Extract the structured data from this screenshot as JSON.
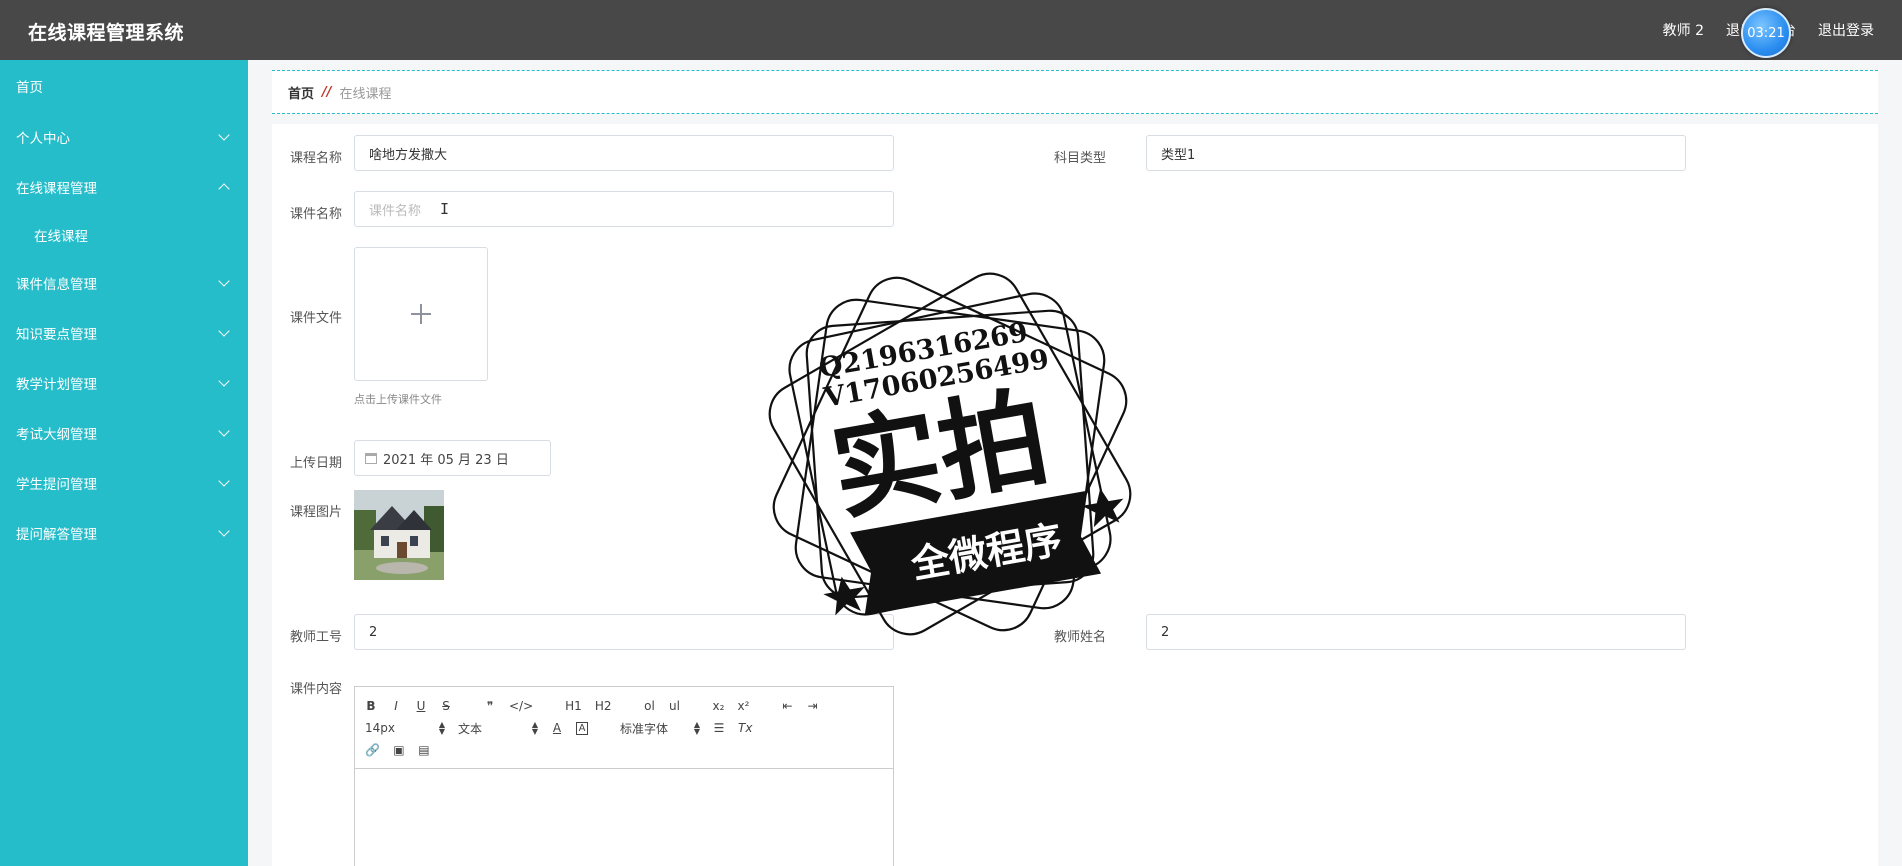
{
  "app": {
    "title": "在线课程管理系统"
  },
  "topbar": {
    "user": "教师 2",
    "return_front": "退出到前台",
    "logout": "退出登录",
    "timer": "03:21"
  },
  "sidebar": {
    "items": [
      {
        "label": "首页",
        "expandable": false
      },
      {
        "label": "个人中心",
        "expandable": true,
        "expanded": false
      },
      {
        "label": "在线课程管理",
        "expandable": true,
        "expanded": true,
        "children": [
          {
            "label": "在线课程"
          }
        ]
      },
      {
        "label": "课件信息管理",
        "expandable": true,
        "expanded": false
      },
      {
        "label": "知识要点管理",
        "expandable": true,
        "expanded": false
      },
      {
        "label": "教学计划管理",
        "expandable": true,
        "expanded": false
      },
      {
        "label": "考试大纲管理",
        "expandable": true,
        "expanded": false
      },
      {
        "label": "学生提问管理",
        "expandable": true,
        "expanded": false
      },
      {
        "label": "提问解答管理",
        "expandable": true,
        "expanded": false
      }
    ]
  },
  "breadcrumb": {
    "home": "首页",
    "separator": "//",
    "current": "在线课程"
  },
  "form": {
    "course_name": {
      "label": "课程名称",
      "value": "啥地方发撒大"
    },
    "subject_type": {
      "label": "科目类型",
      "value": "类型1"
    },
    "courseware_name": {
      "label": "课件名称",
      "placeholder": "课件名称"
    },
    "courseware_file": {
      "label": "课件文件",
      "tip": "点击上传课件文件"
    },
    "upload_date": {
      "label": "上传日期",
      "value": "2021 年 05 月 23 日"
    },
    "course_image": {
      "label": "课程图片"
    },
    "teacher_id": {
      "label": "教师工号",
      "value": "2"
    },
    "teacher_name": {
      "label": "教师姓名",
      "value": "2"
    },
    "content": {
      "label": "课件内容"
    }
  },
  "editor": {
    "row1": [
      "B",
      "I",
      "U",
      "S",
      "❞",
      "</>",
      "H1",
      "H2",
      "ol",
      "ul",
      "x₂",
      "x²",
      "⇤",
      "⇥"
    ],
    "font_size": "14px",
    "text_style": "文本",
    "font_family": "标准字体",
    "clear_format": "Tx"
  },
  "watermark": {
    "line1": "Q2196316269",
    "line2": "V17060256499",
    "big": "实拍",
    "banner": "全微程序"
  },
  "colors": {
    "topbar": "#484848",
    "sidebar": "#26bdca",
    "breadcrumb_sep": "#c0392b"
  }
}
